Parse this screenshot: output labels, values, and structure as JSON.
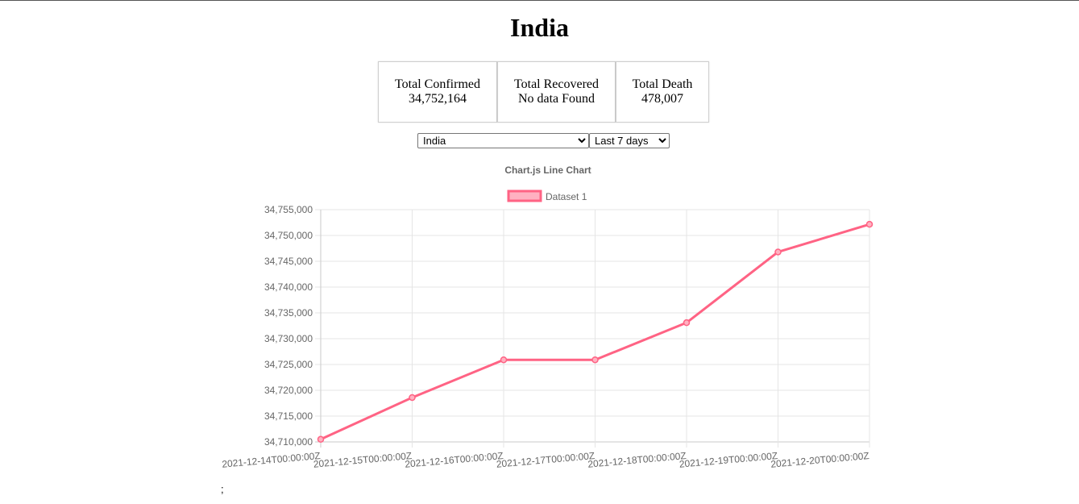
{
  "country_title": "India",
  "stats": {
    "confirmed": {
      "label": "Total Confirmed",
      "value": "34,752,164"
    },
    "recovered": {
      "label": "Total Recovered",
      "value": "No data Found"
    },
    "death": {
      "label": "Total Death",
      "value": "478,007"
    }
  },
  "controls": {
    "country": {
      "selected": "India"
    },
    "range": {
      "selected": "Last 7 days"
    }
  },
  "chart_data": {
    "type": "line",
    "title": "Chart.js Line Chart",
    "x": [
      "2021-12-14T00:00:00Z",
      "2021-12-15T00:00:00Z",
      "2021-12-16T00:00:00Z",
      "2021-12-17T00:00:00Z",
      "2021-12-18T00:00:00Z",
      "2021-12-19T00:00:00Z",
      "2021-12-20T00:00:00Z"
    ],
    "series": [
      {
        "name": "Dataset 1",
        "values": [
          34710500,
          34718600,
          34725900,
          34725900,
          34733100,
          34746800,
          34752164
        ]
      }
    ],
    "ylim": [
      34710000,
      34755000
    ],
    "yticks": [
      "34,710,000",
      "34,715,000",
      "34,720,000",
      "34,725,000",
      "34,730,000",
      "34,735,000",
      "34,740,000",
      "34,745,000",
      "34,750,000",
      "34,755,000"
    ],
    "grid": true,
    "legend": "top",
    "line_color": "#ff6384",
    "fill_color": "#ffb1c1"
  },
  "trailing_text": ";"
}
